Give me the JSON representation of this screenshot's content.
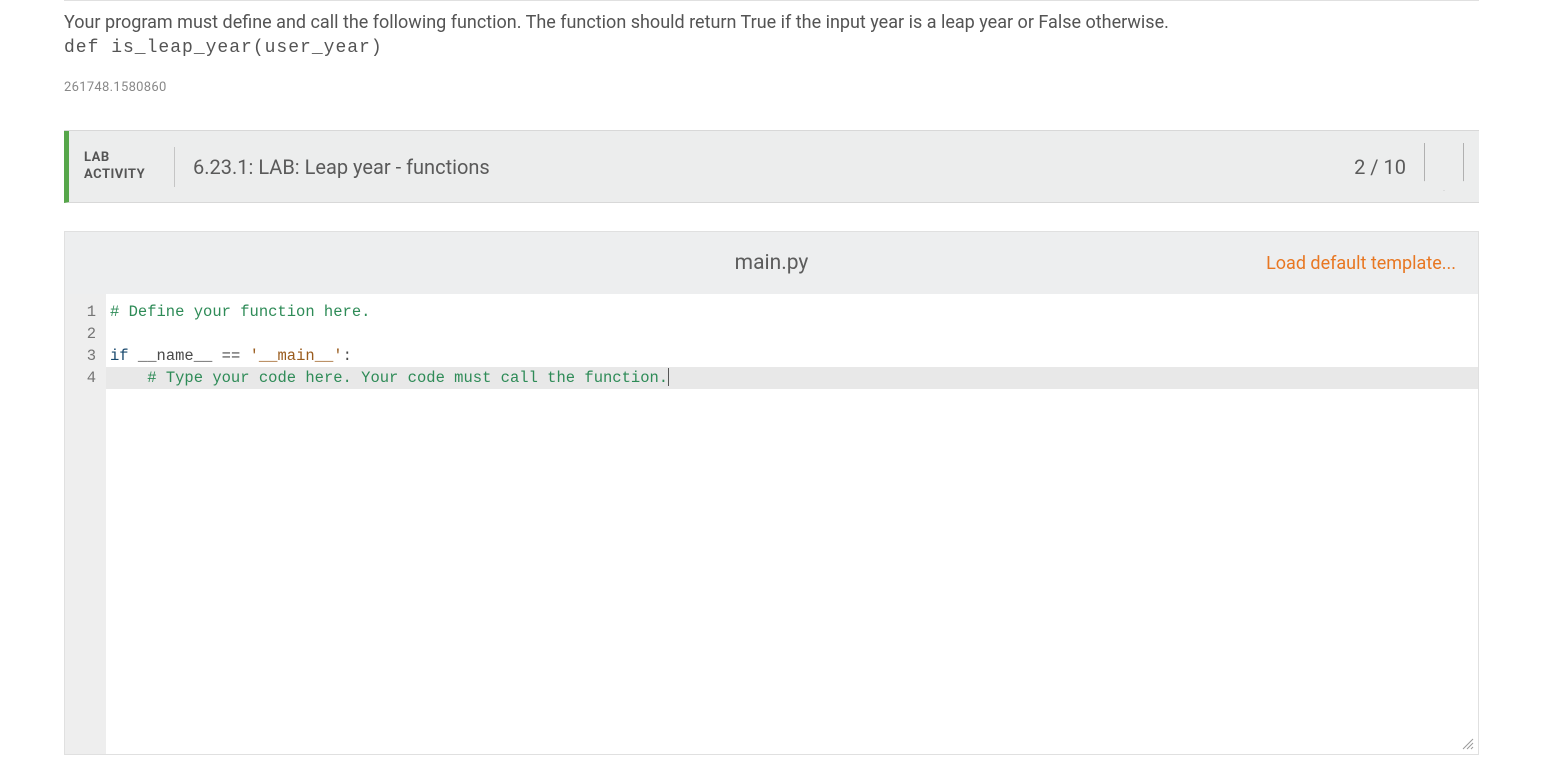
{
  "instructions": {
    "text": "Your program must define and call the following function. The function should return True if the input year is a leap year or False otherwise.",
    "code": "def is_leap_year(user_year)"
  },
  "serial": "261748.1580860",
  "lab": {
    "label_line1": "LAB",
    "label_line2": "ACTIVITY",
    "title": "6.23.1: LAB: Leap year - functions",
    "score": "2 / 10"
  },
  "editor": {
    "filename": "main.py",
    "load_template": "Load default template...",
    "gutter": [
      "1",
      "2",
      "3",
      "4"
    ],
    "lines": {
      "l1_comment": "# Define your function here.",
      "l3_if": "if",
      "l3_name": "__name__",
      "l3_eq": "==",
      "l3_main": "'__main__'",
      "l3_colon": ":",
      "l4_indent": "    ",
      "l4_comment": "# Type your code here. Your code must call the function."
    }
  }
}
